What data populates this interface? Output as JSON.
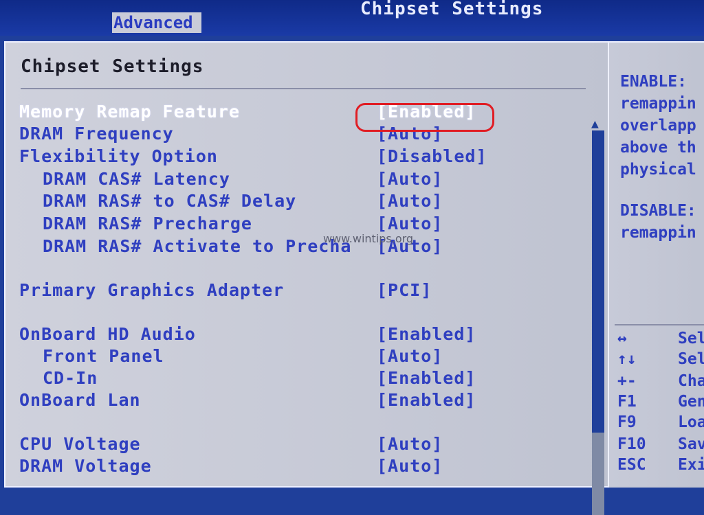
{
  "header": {
    "title": "Chipset Settings",
    "active_tab": "Advanced"
  },
  "main": {
    "section_title": "Chipset Settings",
    "settings": [
      {
        "label": "Memory Remap Feature",
        "value": "[Enabled]"
      },
      {
        "label": "DRAM Frequency",
        "value": "[Auto]"
      },
      {
        "label": "Flexibility Option",
        "value": "[Disabled]"
      },
      {
        "label": "DRAM CAS# Latency",
        "value": "[Auto]"
      },
      {
        "label": "DRAM RAS# to CAS# Delay",
        "value": "[Auto]"
      },
      {
        "label": "DRAM RAS# Precharge",
        "value": "[Auto]"
      },
      {
        "label": "DRAM RAS# Activate to Precha",
        "value": "[Auto]"
      },
      {
        "label": "Primary Graphics Adapter",
        "value": "[PCI]"
      },
      {
        "label": "OnBoard HD Audio",
        "value": "[Enabled]"
      },
      {
        "label": "Front Panel",
        "value": "[Auto]"
      },
      {
        "label": "CD-In",
        "value": "[Enabled]"
      },
      {
        "label": "OnBoard Lan",
        "value": "[Enabled]"
      },
      {
        "label": "CPU Voltage",
        "value": "[Auto]"
      },
      {
        "label": "DRAM Voltage",
        "value": "[Auto]"
      }
    ],
    "watermark": "www.wintips.org"
  },
  "help": {
    "lines": [
      "ENABLE:",
      "remappin",
      "overlapp",
      "above th",
      "physical",
      "DISABLE:",
      "remappin"
    ],
    "keys": [
      {
        "key": "↔",
        "desc": "Sel"
      },
      {
        "key": "↑↓",
        "desc": "Sel"
      },
      {
        "key": "+-",
        "desc": "Cha"
      },
      {
        "key": "F1",
        "desc": "Gen"
      },
      {
        "key": "F9",
        "desc": "Loa"
      },
      {
        "key": "F10",
        "desc": "Sav"
      },
      {
        "key": "ESC",
        "desc": "Exi"
      }
    ]
  },
  "colors": {
    "bios_blue": "#1f3f9a",
    "item_blue": "#2f3fc0",
    "panel_gray": "#c9ccd8",
    "highlight_ring": "#e01d24"
  }
}
